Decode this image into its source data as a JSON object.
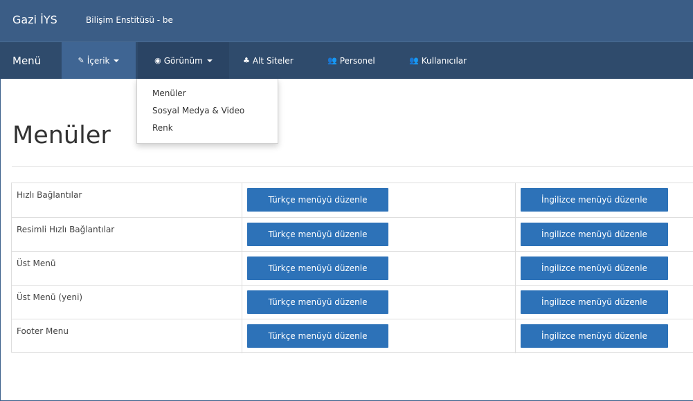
{
  "header": {
    "brand": "Gazi İYS",
    "site_name": "Bilişim Enstitüsü - be"
  },
  "nav": {
    "menu_label": "Menü",
    "items": [
      {
        "label": "İçerik",
        "icon": "edit-icon",
        "has_caret": true
      },
      {
        "label": "Görünüm",
        "icon": "eye-icon",
        "has_caret": true
      },
      {
        "label": "Alt Siteler",
        "icon": "sitemap-icon"
      },
      {
        "label": "Personel",
        "icon": "users-icon"
      },
      {
        "label": "Kullanıcılar",
        "icon": "users-icon"
      }
    ]
  },
  "dropdown": {
    "items": [
      "Menüler",
      "Sosyal Medya & Video",
      "Renk"
    ]
  },
  "page": {
    "title": "Menüler"
  },
  "menus": [
    {
      "name": "Hızlı Bağlantılar",
      "tr_button": "Türkçe menüyü düzenle",
      "en_button": "İngilizce menüyü düzenle"
    },
    {
      "name": "Resimli Hızlı Bağlantılar",
      "tr_button": "Türkçe menüyü düzenle",
      "en_button": "İngilizce menüyü düzenle"
    },
    {
      "name": "Üst Menü",
      "tr_button": "Türkçe menüyü düzenle",
      "en_button": "İngilizce menüyü düzenle"
    },
    {
      "name": "Üst Menü (yeni)",
      "tr_button": "Türkçe menüyü düzenle",
      "en_button": "İngilizce menüyü düzenle"
    },
    {
      "name": "Footer Menu",
      "tr_button": "Türkçe menüyü düzenle",
      "en_button": "İngilizce menüyü düzenle"
    }
  ],
  "colors": {
    "header_bg": "#3b5d86",
    "navbar_bg": "#2f4b6c",
    "active_nav_bg": "#3f6593",
    "button_bg": "#2d72b8"
  }
}
